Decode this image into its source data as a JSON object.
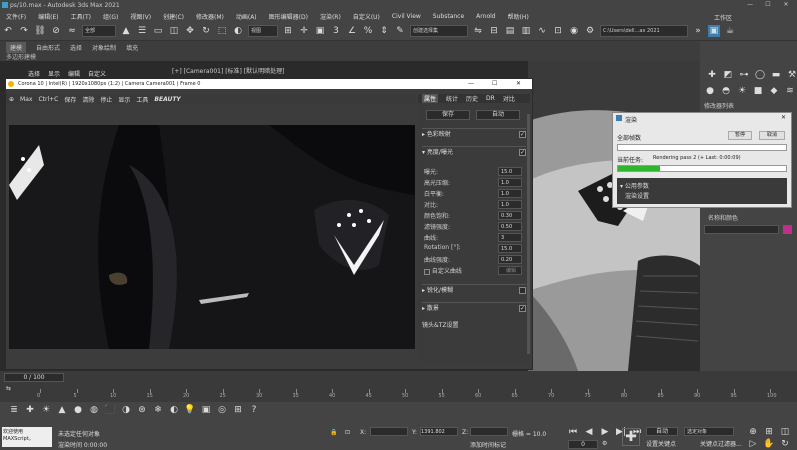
{
  "window": {
    "title": "ps/10.max - Autodesk 3ds Max 2021"
  },
  "menu": [
    "文件(F)",
    "编辑(E)",
    "工具(T)",
    "组(G)",
    "视图(V)",
    "创建(C)",
    "修改器(M)",
    "动画(A)",
    "图形编辑器(D)",
    "渲染(R)",
    "自定义(U)",
    "Civil View",
    "Substance",
    "Arnold",
    "帮助(H)",
    "工作区"
  ],
  "toolbar": {
    "selection_filter": "全部",
    "view_dropdown": "视图",
    "selection_set": "创建选择集",
    "project_path": "C:\\Users\\dell...ax 2021"
  },
  "ribbon": {
    "tabs": [
      "建模",
      "自由形式",
      "选择",
      "对象绘制",
      "填充"
    ],
    "active_tab": "建模",
    "sub_label": "多边形建模"
  },
  "viewport": {
    "menu": [
      "选择",
      "显示",
      "编辑",
      "自定义"
    ],
    "label": "[+] [Camera001] [标准] [默认明暗处理]"
  },
  "vfb": {
    "title": "Corona 10 | Intel(R) | 1920x1080px (1:2) | Camera Camera001 | Frame 0",
    "toolbar": [
      "Max",
      "Ctrl+C",
      "保存",
      "清除",
      "停止",
      "显示",
      "工具",
      "BEAUTY"
    ],
    "tabs": [
      "属性",
      "统计",
      "历史",
      "DR",
      "对比"
    ],
    "action_buttons": [
      "保存",
      "自动"
    ],
    "sections": {
      "color_mapping": "色彩映射",
      "exposure": "亮度/曝光",
      "sharpen": "锐化/模糊",
      "bloom": "散景",
      "lut": "镜头&TZ设置"
    },
    "props": [
      {
        "label": "曝光:",
        "value": "15.0"
      },
      {
        "label": "高光压缩:",
        "value": "1.0"
      },
      {
        "label": "白平衡:",
        "value": "1.0"
      },
      {
        "label": "对比:",
        "value": "1.0"
      },
      {
        "label": "颜色饱和:",
        "value": "0.30"
      },
      {
        "label": "滤镜强度:",
        "value": "0.50"
      },
      {
        "label": "曲线:",
        "value": "3"
      },
      {
        "label": "Rotation [°]:",
        "value": "15.0"
      },
      {
        "label": "曲线强度:",
        "value": "0.20"
      }
    ],
    "custom_curve": "自定义曲线",
    "custom_curve_btn": "编辑"
  },
  "progress": {
    "title": "渲染",
    "total_label": "全部帧数",
    "pause_btn": "暂停",
    "cancel_btn": "取消",
    "current_label": "当前任务:",
    "current_task": "Rendering pass 2 (+ Last: 0:00:09)",
    "frame_fraction": 0.25,
    "common_params": "公用参数",
    "render_settings": "渲染设置"
  },
  "cmdpanel": {
    "label": "修改器列表",
    "object_label": "名称和颜色",
    "color": "#c0308a"
  },
  "timeline": {
    "frame_display": "0 / 100",
    "ticks": [
      "0",
      "5",
      "10",
      "15",
      "20",
      "25",
      "30",
      "35",
      "40",
      "45",
      "50",
      "55",
      "60",
      "65",
      "70",
      "75",
      "80",
      "85",
      "90",
      "95",
      "100"
    ]
  },
  "status": {
    "script_label": "欢迎使用MAXScript。",
    "selected_text": "未选定任何对象",
    "render_time": "渲染时间 0:00:00",
    "x_label": "X:",
    "y_label": "Y:",
    "z_label": "Z:",
    "y_value": "1391.802",
    "grid_label": "栅格 = 10.0",
    "add_time_tag": "添加时间标记",
    "auto_key": "自动",
    "selected_obj": "选定对象",
    "set_key": "设置关键点",
    "key_filter": "关键点过滤器...",
    "frame": "0",
    "zoom": "..."
  }
}
